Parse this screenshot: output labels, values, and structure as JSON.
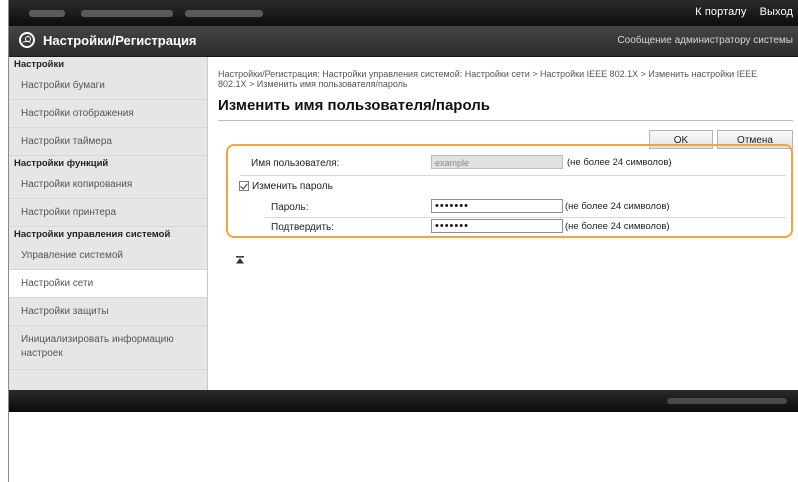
{
  "topbar": {
    "portal_link": "К порталу",
    "logout_link": "Выход"
  },
  "header": {
    "title": "Настройки/Регистрация",
    "admin_message_link": "Сообщение администратору системы"
  },
  "sidebar": {
    "sections": [
      {
        "heading": "Настройки",
        "items": [
          "Настройки бумаги",
          "Настройки отображения",
          "Настройки таймера"
        ]
      },
      {
        "heading": "Настройки функций",
        "items": [
          "Настройки копирования",
          "Настройки принтера"
        ]
      },
      {
        "heading": "Настройки управления системой",
        "items": [
          "Управление системой",
          "Настройки сети",
          "Настройки защиты",
          "Инициализировать информацию настроек"
        ]
      }
    ],
    "active_item": "Настройки сети"
  },
  "main": {
    "breadcrumb": "Настройки/Регистрация: Настройки управления системой: Настройки сети > Настройки IEEE 802.1X > Изменить настройки IEEE 802.1X > Изменить имя пользователя/пароль",
    "page_title": "Изменить имя пользователя/пароль",
    "ok_button": "OK",
    "cancel_button": "Отмена",
    "form": {
      "username_label": "Имя пользователя:",
      "username_value": "example",
      "username_hint": "(не более 24 символов)",
      "change_password_label": "Изменить пароль",
      "change_password_checked": true,
      "password_label": "Пароль:",
      "password_value": "•••••••",
      "password_hint": "(не более 24 символов)",
      "confirm_label": "Подтвердить:",
      "confirm_value": "•••••••",
      "confirm_hint": "(не более 24 символов)"
    }
  },
  "colors": {
    "highlight_border": "#f2a640",
    "topbar": "#111111",
    "sidebar_bg": "#e6e6e6"
  }
}
